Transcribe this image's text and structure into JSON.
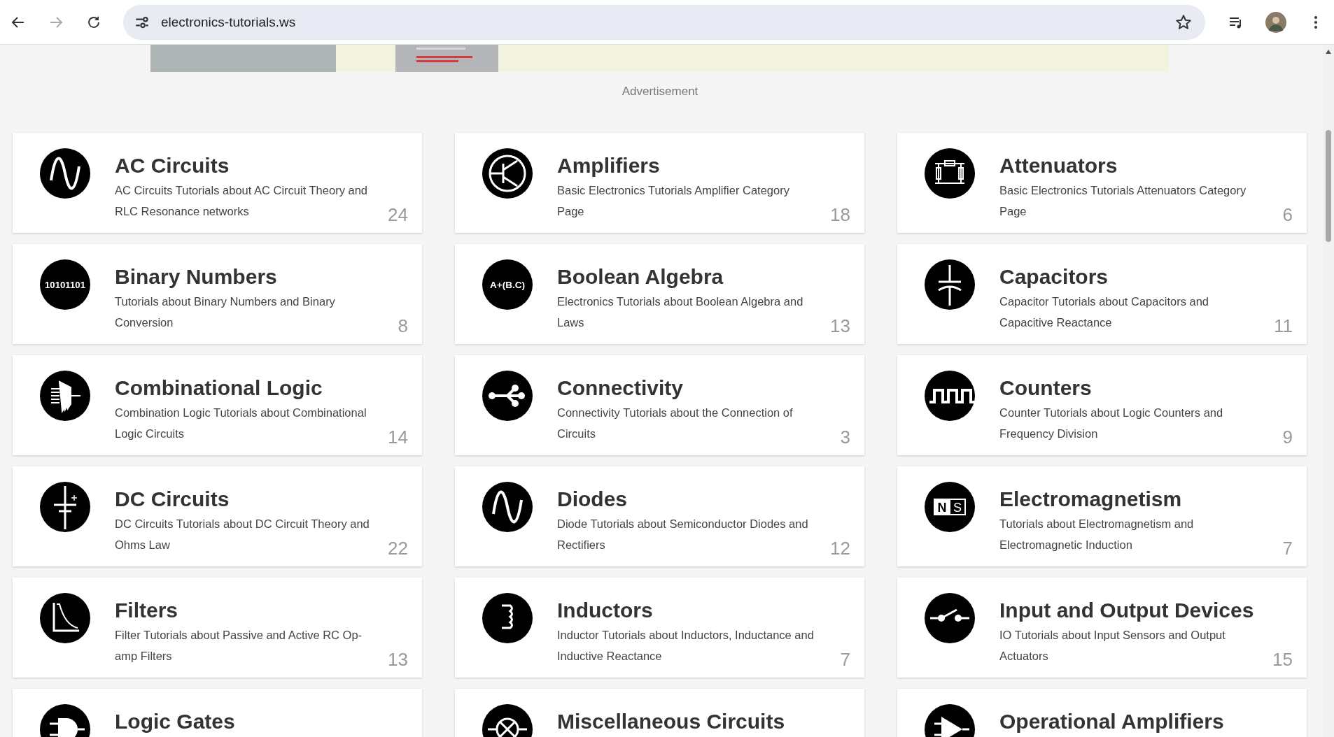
{
  "browser": {
    "url": "electronics-tutorials.ws"
  },
  "ad": {
    "label": "Advertisement",
    "kind": "picture"
  },
  "categories": [
    {
      "title": "AC Circuits",
      "description": "AC Circuits Tutorials about AC Circuit Theory and RLC Resonance networks",
      "count": "24"
    },
    {
      "title": "Amplifiers",
      "description": "Basic Electronics Tutorials Amplifier Category Page",
      "count": "18"
    },
    {
      "title": "Attenuators",
      "description": "Basic Electronics Tutorials Attenuators Category Page",
      "count": "6"
    },
    {
      "title": "Binary Numbers",
      "description": "Tutorials about Binary Numbers and Binary Conversion",
      "count": "8",
      "icon_text": "10101101"
    },
    {
      "title": "Boolean Algebra",
      "description": "Electronics Tutorials about Boolean Algebra and Laws",
      "count": "13",
      "icon_text": "A+(B.C)"
    },
    {
      "title": "Capacitors",
      "description": "Capacitor Tutorials about Capacitors and Capacitive Reactance",
      "count": "11"
    },
    {
      "title": "Combinational Logic",
      "description": "Combination Logic Tutorials about Combinational Logic Circuits",
      "count": "14"
    },
    {
      "title": "Connectivity",
      "description": "Connectivity Tutorials about the Connection of Circuits",
      "count": "3"
    },
    {
      "title": "Counters",
      "description": "Counter Tutorials about Logic Counters and Frequency Division",
      "count": "9"
    },
    {
      "title": "DC Circuits",
      "description": "DC Circuits Tutorials about DC Circuit Theory and Ohms Law",
      "count": "22"
    },
    {
      "title": "Diodes",
      "description": "Diode Tutorials about Semiconductor Diodes and Rectifiers",
      "count": "12"
    },
    {
      "title": "Electromagnetism",
      "description": "Tutorials about Electromagnetism and Electromagnetic Induction",
      "count": "7",
      "icon_texts": [
        "N",
        "S"
      ]
    },
    {
      "title": "Filters",
      "description": "Filter Tutorials about Passive and Active RC Op-amp Filters",
      "count": "13"
    },
    {
      "title": "Inductors",
      "description": "Inductor Tutorials about Inductors, Inductance and Inductive Reactance",
      "count": "7"
    },
    {
      "title": "Input and Output Devices",
      "description": "IO Tutorials about Input Sensors and Output Actuators",
      "count": "15"
    },
    {
      "title": "Logic Gates"
    },
    {
      "title": "Miscellaneous Circuits"
    },
    {
      "title": "Operational Amplifiers"
    }
  ]
}
